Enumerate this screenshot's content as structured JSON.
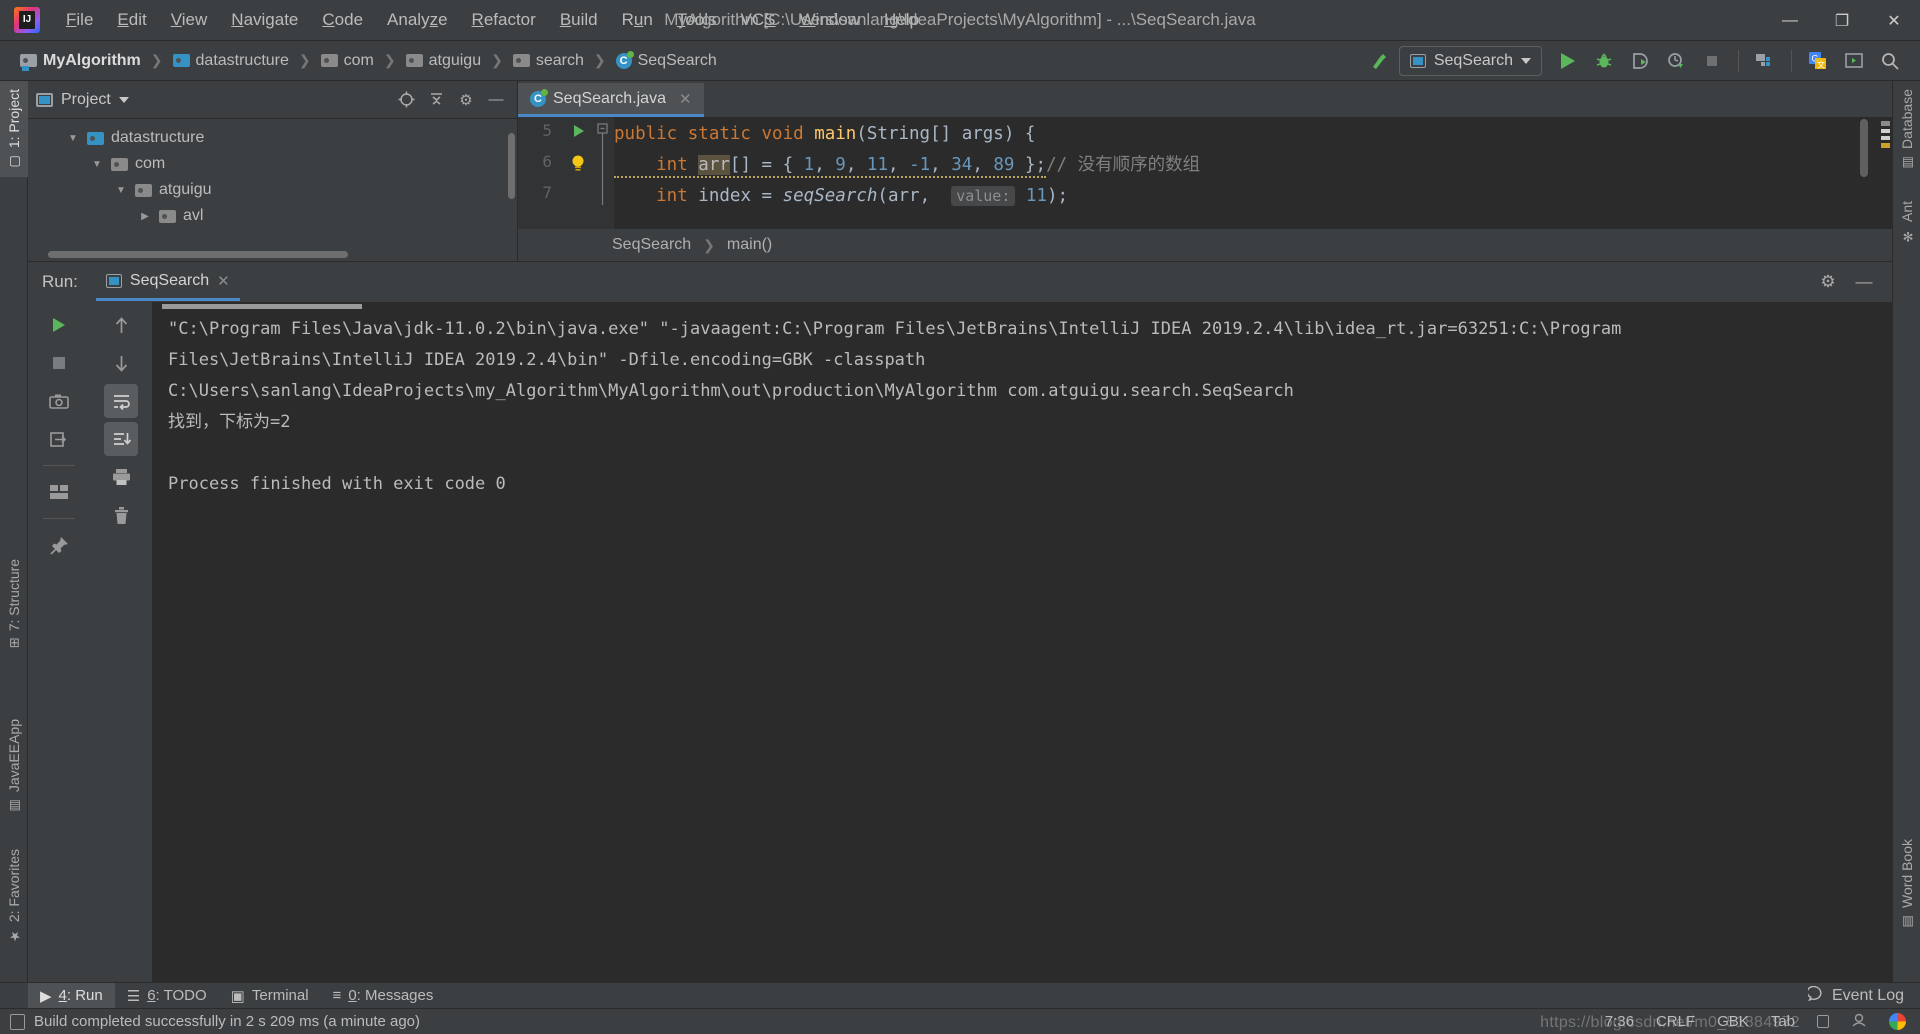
{
  "window": {
    "title": "MyAlgorithm [C:\\Users\\sanlang\\IdeaProjects\\MyAlgorithm] - ...\\SeqSearch.java",
    "logo": "intellij-idea-logo",
    "minimize": "—",
    "maximize": "❐",
    "close": "✕"
  },
  "menu": {
    "items": [
      {
        "label": "File"
      },
      {
        "label": "Edit"
      },
      {
        "label": "View"
      },
      {
        "label": "Navigate"
      },
      {
        "label": "Code"
      },
      {
        "label": "Analyze"
      },
      {
        "label": "Refactor"
      },
      {
        "label": "Build"
      },
      {
        "label": "Run"
      },
      {
        "label": "Tools"
      },
      {
        "label": "VCS"
      },
      {
        "label": "Window"
      },
      {
        "label": "Help"
      }
    ]
  },
  "breadcrumb": {
    "items": [
      {
        "label": "MyAlgorithm",
        "icon": "project-folder-icon"
      },
      {
        "label": "datastructure",
        "icon": "folder-blue-icon"
      },
      {
        "label": "com",
        "icon": "package-folder-icon"
      },
      {
        "label": "atguigu",
        "icon": "package-folder-icon"
      },
      {
        "label": "search",
        "icon": "package-folder-icon"
      },
      {
        "label": "SeqSearch",
        "icon": "java-class-icon"
      }
    ],
    "separator": "❯"
  },
  "toolbar": {
    "build_hammer": "build-icon",
    "run_config_name": "SeqSearch",
    "run": "run-icon",
    "debug": "debug-icon",
    "run_with_coverage": "run-coverage-icon",
    "profile": "profiler-icon",
    "stop": "stop-icon",
    "project_structure": "project-structure-icon",
    "translate": "google-translate-icon",
    "terminal": "terminal-icon",
    "search_everywhere": "search-icon"
  },
  "left_tool_strip": {
    "items": [
      {
        "label": "1: Project",
        "icon": "project-icon",
        "active": true
      },
      {
        "label": "7: Structure",
        "icon": "structure-icon",
        "active": false
      },
      {
        "label": "JavaEEApp",
        "icon": "javaee-icon",
        "active": false
      },
      {
        "label": "2: Favorites",
        "icon": "star-icon",
        "active": false
      }
    ]
  },
  "right_tool_strip": {
    "items": [
      {
        "label": "Database",
        "icon": "database-icon"
      },
      {
        "label": "Ant",
        "icon": "ant-icon"
      },
      {
        "label": "Word Book",
        "icon": "book-icon"
      }
    ]
  },
  "project_panel": {
    "title": "Project",
    "dropdown": "▾",
    "actions": [
      {
        "name": "locate-icon",
        "glyph": "⊕"
      },
      {
        "name": "collapse-all-icon",
        "glyph": "⩳"
      },
      {
        "name": "settings-gear-icon",
        "glyph": "⚙"
      },
      {
        "name": "hide-panel-icon",
        "glyph": "—"
      }
    ],
    "tree": [
      {
        "label": "datastructure",
        "indent": 1,
        "twist": "▼",
        "icon": "folder-blue-icon"
      },
      {
        "label": "com",
        "indent": 2,
        "twist": "▼",
        "icon": "package-folder-icon"
      },
      {
        "label": "atguigu",
        "indent": 3,
        "twist": "▼",
        "icon": "package-folder-icon"
      },
      {
        "label": "avl",
        "indent": 4,
        "twist": "▶",
        "icon": "package-folder-icon"
      }
    ]
  },
  "editor": {
    "tab": {
      "label": "SeqSearch.java",
      "icon": "java-class-icon",
      "close": "✕"
    },
    "lines": [
      {
        "number": "5",
        "marker": "run-gutter-icon",
        "fold": "fold-icon",
        "text": "        public static void main(String[] args) {"
      },
      {
        "number": "6",
        "marker": "",
        "fold": "",
        "text": "            int arr[] = { 1, 9, 11, -1, 34, 89 };// 没有顺序的数组"
      },
      {
        "number": "7",
        "marker": "intention-bulb-icon",
        "fold": "",
        "text": "            int index = seqSearch(arr,  value: 11);"
      }
    ],
    "param_hint": "value:",
    "breadcrumb": [
      "SeqSearch",
      "main()"
    ],
    "breadcrumb_sep": "❯"
  },
  "run_window": {
    "label": "Run:",
    "tab": {
      "label": "SeqSearch",
      "icon": "run-config-icon",
      "close": "✕"
    },
    "header_actions": [
      {
        "name": "settings-gear-icon",
        "glyph": "⚙"
      },
      {
        "name": "hide-panel-icon",
        "glyph": "—"
      }
    ],
    "toolbar_left": [
      {
        "name": "rerun-button",
        "glyph": "▶"
      },
      {
        "name": "stop-button",
        "glyph": "■"
      },
      {
        "name": "screenshot-button",
        "glyph": "⬜"
      },
      {
        "name": "export-button",
        "glyph": "⮕"
      },
      {
        "name": "layout-button",
        "glyph": "▤"
      },
      {
        "name": "pin-tab-button",
        "glyph": "⌖"
      }
    ],
    "toolbar_right": [
      {
        "name": "up-arrow-button",
        "glyph": "↑"
      },
      {
        "name": "down-arrow-button",
        "glyph": "↓"
      },
      {
        "name": "soft-wrap-button",
        "glyph": "↩"
      },
      {
        "name": "scroll-to-end-button",
        "glyph": "↓"
      },
      {
        "name": "print-button",
        "glyph": "⎙"
      },
      {
        "name": "clear-all-button",
        "glyph": "🗑"
      }
    ],
    "console": [
      "\"C:\\Program Files\\Java\\jdk-11.0.2\\bin\\java.exe\" \"-javaagent:C:\\Program Files\\JetBrains\\IntelliJ IDEA 2019.2.4\\lib\\idea_rt.jar=63251:C:\\Program",
      " Files\\JetBrains\\IntelliJ IDEA 2019.2.4\\bin\" -Dfile.encoding=GBK -classpath",
      " C:\\Users\\sanlang\\IdeaProjects\\my_Algorithm\\MyAlgorithm\\out\\production\\MyAlgorithm com.atguigu.search.SeqSearch",
      "找到，下标为=2",
      "",
      "Process finished with exit code 0"
    ]
  },
  "bottom_tabs": {
    "items": [
      {
        "label": "4: Run",
        "icon": "run-icon",
        "active": true
      },
      {
        "label": "6: TODO",
        "icon": "todo-icon",
        "active": false
      },
      {
        "label": "Terminal",
        "icon": "terminal-icon",
        "active": false
      },
      {
        "label": "0: Messages",
        "icon": "messages-icon",
        "active": false
      }
    ],
    "event_log": {
      "label": "Event Log",
      "icon": "event-log-icon"
    }
  },
  "statusbar": {
    "message": "Build completed successfully in 2 s 209 ms (a minute ago)",
    "message_icon": "build-status-icon",
    "caret_position": "7:36",
    "line_separator": "CRLF",
    "encoding": "GBK",
    "indent": "Tab",
    "lock_icon": "read-only-lock-icon",
    "inspector_icon": "inspection-icon",
    "google_icon": "google-icon",
    "watermark": "https://blog.csdn.net/m0_51884972"
  },
  "colors": {
    "accent_blue": "#4a88c7",
    "panel_bg": "#3c3f41",
    "editor_bg": "#2b2b2b",
    "keyword": "#cc7832",
    "number": "#6897bb",
    "method": "#ffc66d",
    "comment": "#808080",
    "green_run": "#5bb75b"
  }
}
